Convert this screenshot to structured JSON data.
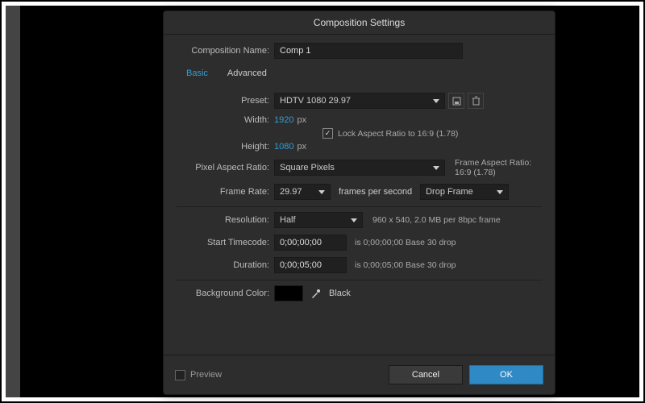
{
  "title": "Composition Settings",
  "nameLabel": "Composition Name:",
  "nameValue": "Comp 1",
  "tabs": {
    "basic": "Basic",
    "advanced": "Advanced"
  },
  "preset": {
    "label": "Preset:",
    "value": "HDTV 1080 29.97"
  },
  "width": {
    "label": "Width:",
    "value": "1920",
    "unit": "px"
  },
  "height": {
    "label": "Height:",
    "value": "1080",
    "unit": "px"
  },
  "lockAR": "Lock Aspect Ratio to 16:9 (1.78)",
  "par": {
    "label": "Pixel Aspect Ratio:",
    "value": "Square Pixels"
  },
  "farLabel": "Frame Aspect Ratio:",
  "farValue": "16:9 (1.78)",
  "fps": {
    "label": "Frame Rate:",
    "value": "29.97",
    "suffix": "frames per second",
    "mode": "Drop Frame"
  },
  "res": {
    "label": "Resolution:",
    "value": "Half",
    "info": "960 x 540, 2.0 MB per 8bpc frame"
  },
  "start": {
    "label": "Start Timecode:",
    "value": "0;00;00;00",
    "info": "is 0;00;00;00 Base 30  drop"
  },
  "dur": {
    "label": "Duration:",
    "value": "0;00;05;00",
    "info": "is 0;00;05;00 Base 30  drop"
  },
  "bg": {
    "label": "Background Color:",
    "name": "Black"
  },
  "preview": "Preview",
  "cancel": "Cancel",
  "ok": "OK"
}
